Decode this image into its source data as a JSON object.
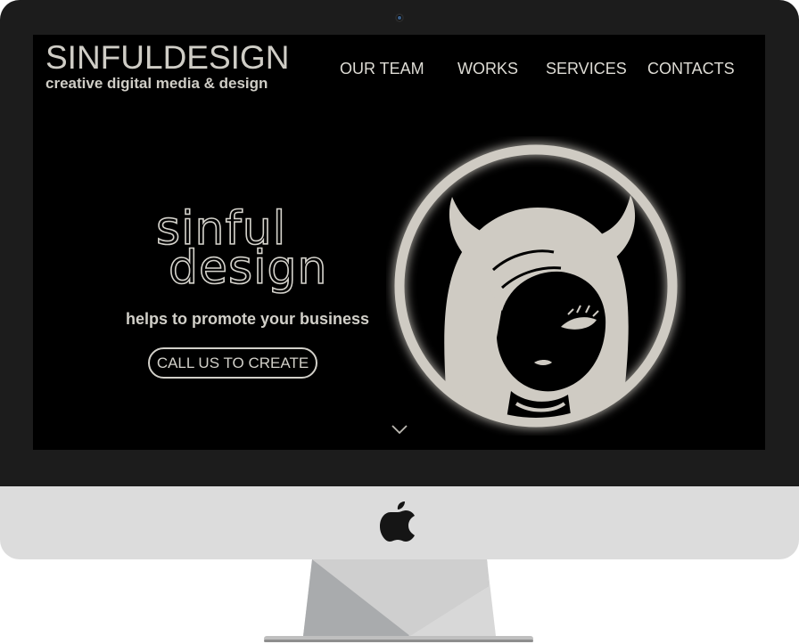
{
  "site": {
    "logo_title": "SINFULDESIGN",
    "logo_subtitle": "creative digital media & design"
  },
  "nav": {
    "items": [
      {
        "label": "OUR TEAM"
      },
      {
        "label": "WORKS"
      },
      {
        "label": "SERVICES"
      },
      {
        "label": "CONTACTS"
      }
    ]
  },
  "hero": {
    "wordmark_line1": "sinful",
    "wordmark_line2": "design",
    "tagline": "helps to promote your business",
    "cta_label": "CALL US TO CREATE"
  },
  "icons": {
    "emblem": "devil-girl-emblem-icon",
    "scroll": "chevron-down-icon",
    "brand": "apple-logo-icon",
    "camera": "webcam-icon"
  },
  "colors": {
    "page_background": "#000000",
    "text": "#d2d0c9",
    "bezel": "#1c1c1c",
    "chin": "#dcdcdc"
  }
}
